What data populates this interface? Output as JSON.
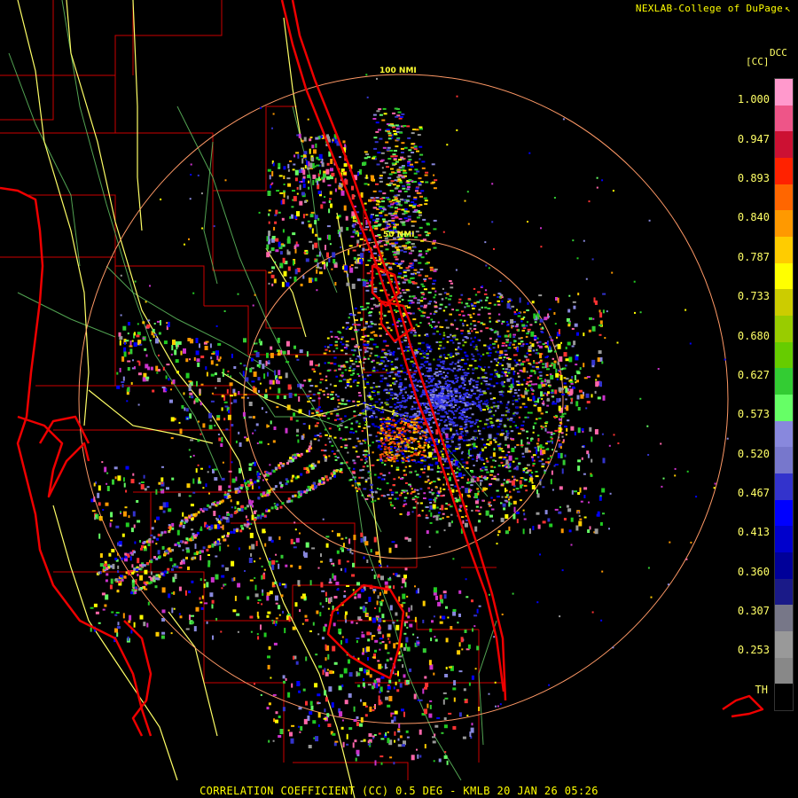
{
  "credit": "NEXLAB-College of DuPage",
  "credit_icon": "cursor-arrow-icon",
  "legend": {
    "product": "DCC",
    "unit": "[CC]",
    "labels": [
      "1.000",
      "0.947",
      "0.893",
      "0.840",
      "0.787",
      "0.733",
      "0.680",
      "0.627",
      "0.573",
      "0.520",
      "0.467",
      "0.413",
      "0.360",
      "0.307",
      "0.253",
      "TH"
    ],
    "colors": [
      "#ff99cc",
      "#ee5588",
      "#cc1133",
      "#ff2200",
      "#ff6600",
      "#ff9900",
      "#ffcc00",
      "#ffff00",
      "#cccc00",
      "#99cc00",
      "#66cc00",
      "#33cc33",
      "#66ff66",
      "#8888dd",
      "#7777cc",
      "#3333cc",
      "#0000ff",
      "#0000cc",
      "#000099",
      "#1a1a88",
      "#777788",
      "#999999",
      "#888888",
      "#000000"
    ]
  },
  "range_rings": [
    "100 NMI",
    "50 NMI"
  ],
  "caption": "CORRELATION COEFFICIENT (CC) 0.5 DEG - KMLB 20 JAN 26 05:26",
  "colors": {
    "state_lines": "#ff3333",
    "roads": "#ffff66",
    "counties": "#cc0000",
    "rivers": "#66cc66",
    "rings": "#ff9966"
  }
}
